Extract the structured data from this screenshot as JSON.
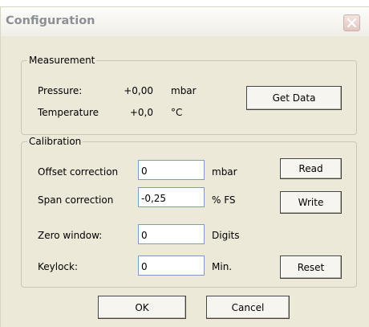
{
  "window": {
    "title": "Configuration",
    "close_icon": "close-icon"
  },
  "measurement": {
    "group_label": "Measurement",
    "pressure": {
      "label": "Pressure:",
      "value": "+0,00",
      "unit": "mbar"
    },
    "temperature": {
      "label": "Temperature",
      "value": "+0,0",
      "unit": "°C"
    },
    "get_data_label": "Get Data"
  },
  "calibration": {
    "group_label": "Calibration",
    "offset": {
      "label": "Offset correction",
      "value": "0",
      "unit": "mbar"
    },
    "span": {
      "label": "Span correction",
      "value": "-0,25",
      "unit": "% FS"
    },
    "zero": {
      "label": "Zero window:",
      "value": "0",
      "unit": "Digits"
    },
    "keylock": {
      "label": "Keylock:",
      "value": "0",
      "unit": "Min."
    },
    "read_label": "Read",
    "write_label": "Write",
    "reset_label": "Reset"
  },
  "footer": {
    "ok_label": "OK",
    "cancel_label": "Cancel"
  },
  "colors": {
    "face": "#ece9d8",
    "close_bg": "#e4c6c1",
    "close_x": "#ffffff",
    "field_border": "#7f9db9"
  }
}
